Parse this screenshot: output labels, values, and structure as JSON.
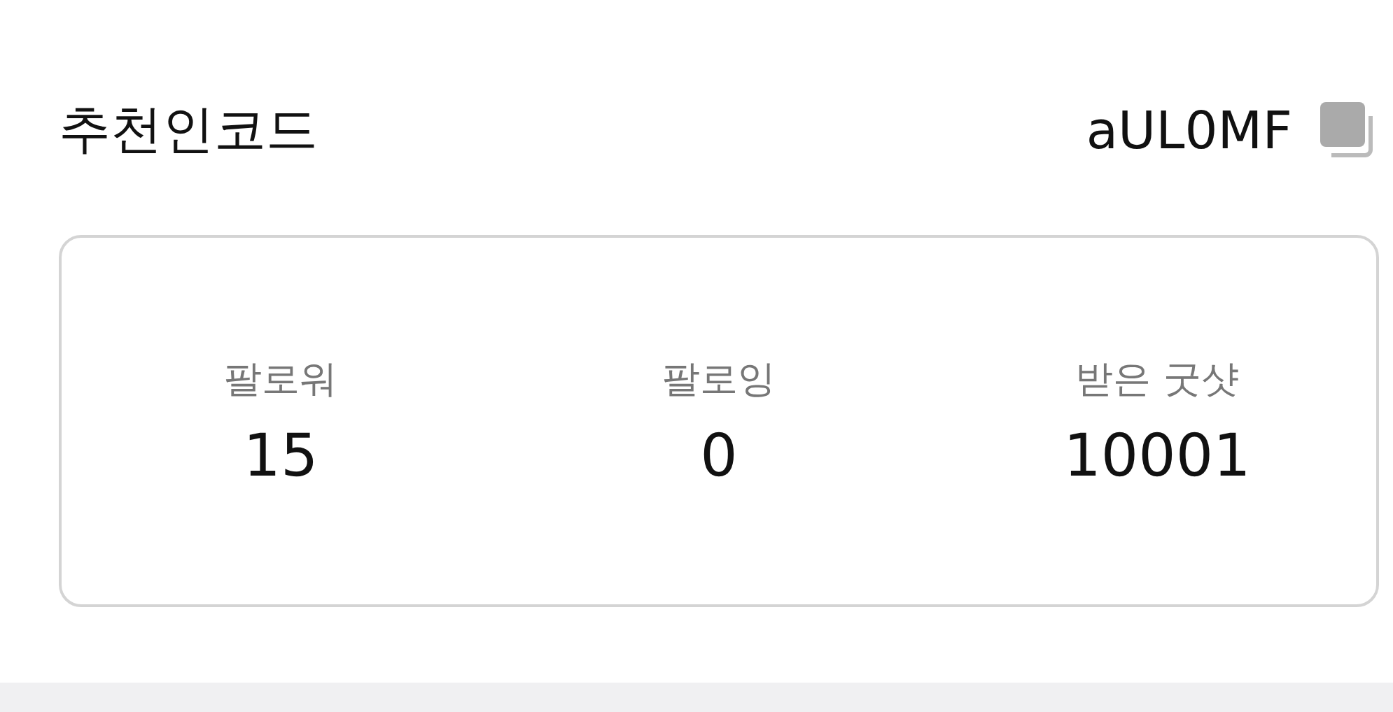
{
  "referral": {
    "label": "추천인코드",
    "code": "aUL0MF"
  },
  "stats": [
    {
      "label": "팔로워",
      "value": "15"
    },
    {
      "label": "팔로잉",
      "value": "0"
    },
    {
      "label": "받은 굿샷",
      "value": "10001"
    }
  ]
}
